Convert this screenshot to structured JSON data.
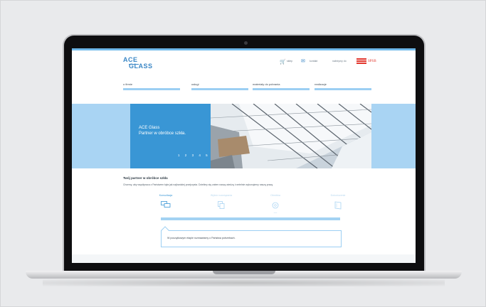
{
  "brand": {
    "logo_line1": "ACE",
    "logo_line2": "GLASS"
  },
  "header": {
    "shop_label": "sklep",
    "contact_label": "kontakt",
    "member_label": "należymy do",
    "spsb_label": "SPSB"
  },
  "nav": {
    "items": [
      {
        "label": "o firmie"
      },
      {
        "label": "usługi"
      },
      {
        "label": "materiały do pobrania"
      },
      {
        "label": "realizacje"
      }
    ]
  },
  "hero": {
    "title_line1": "ACE Glass",
    "title_line2": "Partner w obróbce szkła.",
    "pager": [
      "1",
      "2",
      "3",
      "4",
      "5"
    ]
  },
  "section": {
    "title": "Twój partner w obróbce szkła",
    "description": "Chcemy, aby współpraca z Państwem była jak najbardziej przejrzysta. Dzielimy się zatem naszą wiedzą i rzetelnie wykonujemy naszą pracę."
  },
  "steps": [
    {
      "label": "Konsultacja",
      "icon": "chat-icon",
      "active": true
    },
    {
      "label": "Wybór rozwiązania",
      "icon": "layers-icon",
      "active": false
    },
    {
      "label": "Obróbka",
      "icon": "gear-icon",
      "active": false
    },
    {
      "label": "Dokończenie",
      "icon": "pane-icon",
      "active": false
    }
  ],
  "step_progress": 0.25,
  "info_box": {
    "text": "W początkowym etapie rozmawiamy o Państwa potrzebach."
  },
  "colors": {
    "accent": "#3996d5",
    "light_accent": "#a9d4f3",
    "spsb_red": "#e2372e"
  }
}
